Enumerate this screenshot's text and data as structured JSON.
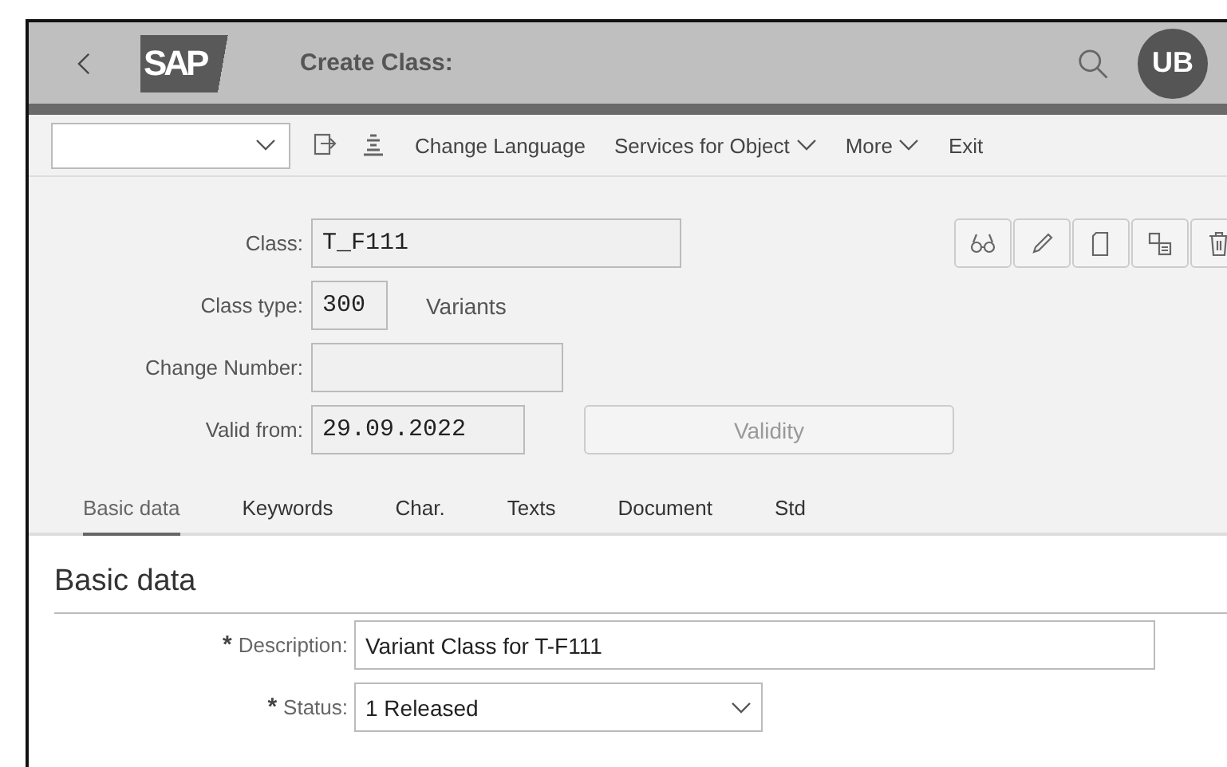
{
  "shell": {
    "logo": "SAP",
    "title": "Create Class:",
    "avatar": "UB"
  },
  "toolbar": {
    "items": [
      {
        "label": "Change Language",
        "caret": false
      },
      {
        "label": "Services for Object",
        "caret": true
      },
      {
        "label": "More",
        "caret": true
      },
      {
        "label": "Exit",
        "caret": false
      }
    ]
  },
  "header_fields": [
    {
      "label": "Class:",
      "value": "T_F111"
    },
    {
      "label": "Class type:",
      "value": "300",
      "note": "Variants"
    },
    {
      "label": "Change Number:"
    },
    {
      "label": "Valid from:",
      "value": "29.09.2022",
      "button": {
        "label": "Validity",
        "disabled": true
      }
    }
  ],
  "tabs": [
    {
      "label": "Basic data",
      "selected": true
    },
    {
      "label": "Keywords",
      "selected": false
    },
    {
      "label": "Char.",
      "selected": false
    },
    {
      "label": "Texts",
      "selected": false
    },
    {
      "label": "Document",
      "selected": false
    },
    {
      "label": "Std",
      "selected": false
    }
  ],
  "section": {
    "title": "Basic data",
    "fields": [
      {
        "kind": "text",
        "mark": "*",
        "label": "Description:",
        "value": "Variant Class for T-F111"
      },
      {
        "kind": "select",
        "mark": "*",
        "label": "Status:",
        "value": "1 Released"
      }
    ]
  }
}
